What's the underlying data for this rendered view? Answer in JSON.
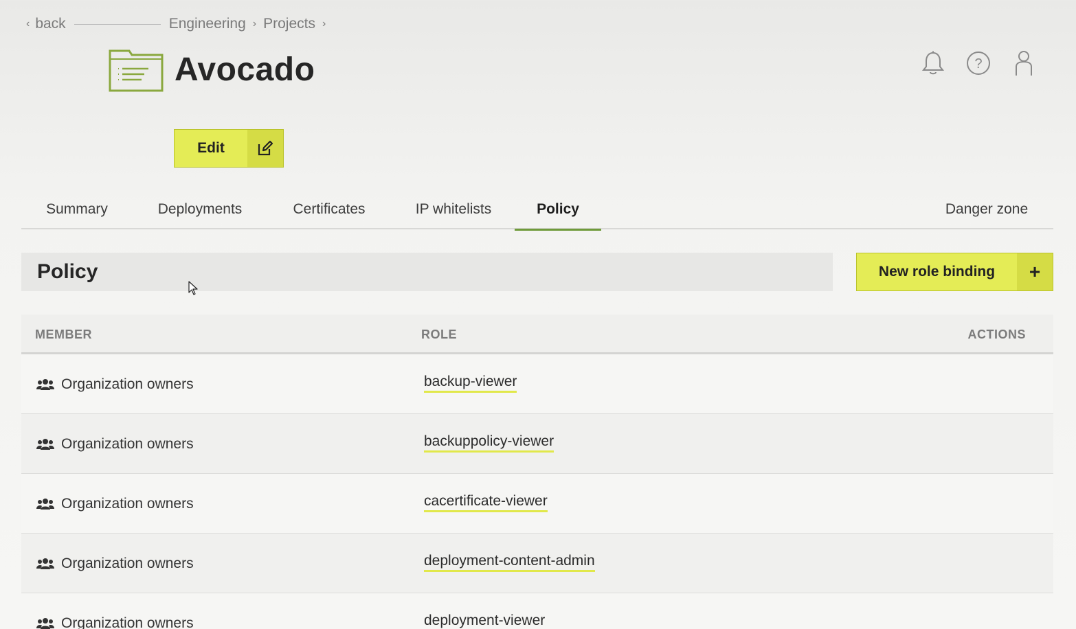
{
  "breadcrumb": {
    "back_label": "back",
    "items": [
      "Engineering",
      "Projects"
    ]
  },
  "header": {
    "title": "Avocado",
    "edit_label": "Edit"
  },
  "tabs": [
    {
      "label": "Summary"
    },
    {
      "label": "Deployments"
    },
    {
      "label": "Certificates"
    },
    {
      "label": "IP whitelists"
    },
    {
      "label": "Policy",
      "active": true
    },
    {
      "label": "Danger zone"
    }
  ],
  "policy": {
    "heading": "Policy",
    "new_button_label": "New role binding",
    "new_button_icon": "+"
  },
  "table": {
    "columns": [
      "MEMBER",
      "ROLE",
      "ACTIONS"
    ],
    "rows": [
      {
        "member": "Organization owners",
        "role": "backup-viewer"
      },
      {
        "member": "Organization owners",
        "role": "backuppolicy-viewer"
      },
      {
        "member": "Organization owners",
        "role": "cacertificate-viewer"
      },
      {
        "member": "Organization owners",
        "role": "deployment-content-admin"
      },
      {
        "member": "Organization owners",
        "role": "deployment-viewer"
      }
    ]
  },
  "icons": {
    "folder": "folder-icon",
    "notifications": "bell-icon",
    "help": "help-icon",
    "account": "user-icon",
    "edit": "edit-icon",
    "group": "users-group-icon"
  },
  "colors": {
    "accent_button": "#e4ec56",
    "active_tab_underline": "#6f9b3a",
    "folder_icon": "#8aa83e"
  }
}
